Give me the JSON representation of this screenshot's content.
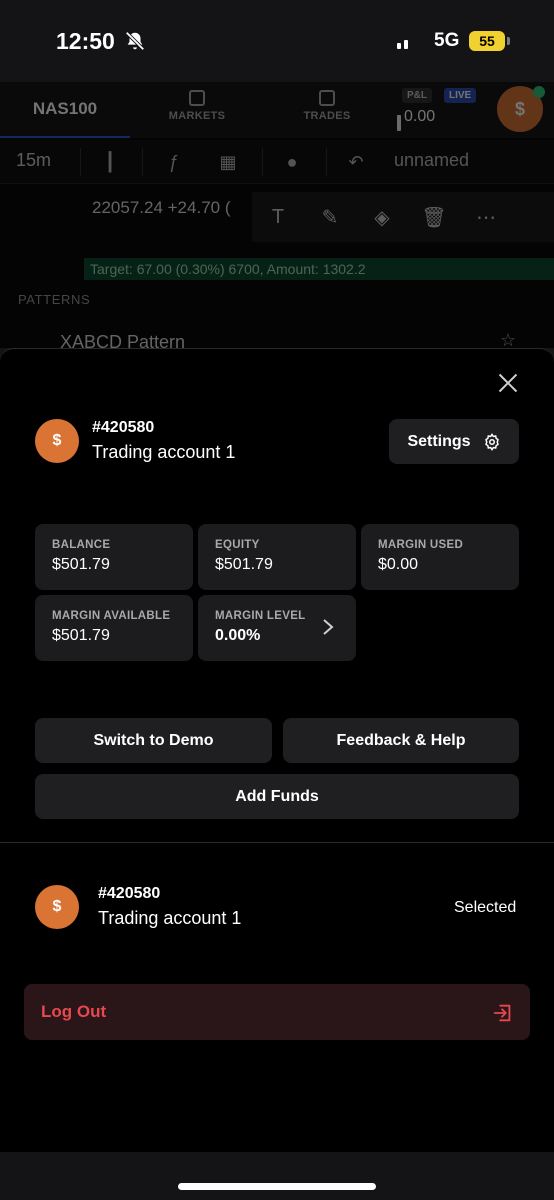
{
  "status_bar": {
    "time": "12:50",
    "network": "5G",
    "battery": "55",
    "icons": [
      "bell-slash-icon",
      "cellular-signal-icon",
      "battery-icon"
    ]
  },
  "background_app": {
    "symbol": "NAS100",
    "tabs": [
      {
        "label": "MARKETS",
        "icon": "markets-icon"
      },
      {
        "label": "TRADES",
        "icon": "trades-icon"
      }
    ],
    "pnl_label": "P&L",
    "live_label": "LIVE",
    "pnl_value": "0.00",
    "avatar_glyph": "$",
    "interval": "15m",
    "layout_name": "unnamed",
    "price_text": "22057.24 +24.70 (",
    "target_text": "Target: 67.00 (0.30%) 6700, Amount: 1302.2",
    "patterns_label": "PATTERNS",
    "pattern_item": "XABCD Pattern"
  },
  "sheet": {
    "account": {
      "avatar_glyph": "$",
      "id": "#420580",
      "name": "Trading account 1"
    },
    "settings_label": "Settings",
    "stats": [
      {
        "label": "BALANCE",
        "value": "$501.79"
      },
      {
        "label": "EQUITY",
        "value": "$501.79"
      },
      {
        "label": "MARGIN USED",
        "value": "$0.00"
      },
      {
        "label": "MARGIN AVAILABLE",
        "value": "$501.79"
      },
      {
        "label": "MARGIN LEVEL",
        "value": "0.00%"
      }
    ],
    "switch_demo_label": "Switch to Demo",
    "feedback_label": "Feedback & Help",
    "add_funds_label": "Add Funds",
    "account_list": [
      {
        "avatar_glyph": "$",
        "id": "#420580",
        "name": "Trading account 1",
        "status": "Selected"
      }
    ],
    "logout_label": "Log Out"
  },
  "colors": {
    "accent_orange": "#d97435",
    "danger_red": "#e5484d",
    "live_blue": "#2e4fb5",
    "battery_yellow": "#f1d130"
  }
}
